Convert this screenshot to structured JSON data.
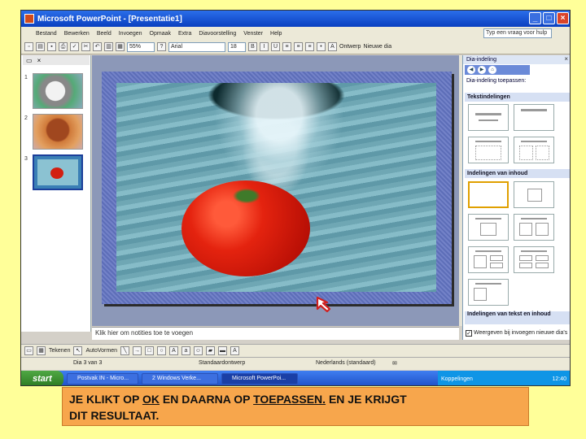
{
  "window": {
    "title": "Microsoft PowerPoint - [Presentatie1]",
    "buttons": [
      "_",
      "□",
      "×"
    ]
  },
  "menu": {
    "items": [
      "Bestand",
      "Bewerken",
      "Beeld",
      "Invoegen",
      "Opmaak",
      "Extra",
      "Diavoorstelling",
      "Venster",
      "Help"
    ],
    "help_placeholder": "Typ een vraag voor hulp"
  },
  "toolbar": {
    "zoom": "55%",
    "font": "Arial",
    "size": "18",
    "design_label": "Ontwerp",
    "new_slide_label": "Nieuwe dia"
  },
  "outline": {
    "tabs": [
      "▭",
      "×"
    ],
    "slides": [
      {
        "number": "1"
      },
      {
        "number": "2"
      },
      {
        "number": "3"
      }
    ]
  },
  "notes": {
    "placeholder": "Klik hier om notities toe te voegen"
  },
  "taskpane": {
    "title": "Dia-indeling",
    "close": "×",
    "subtitle": "Dia-indeling toepassen:",
    "sections": {
      "text": "Tekstindelingen",
      "content": "Indelingen van inhoud",
      "text_content": "Indelingen van tekst en inhoud"
    },
    "checkbox_label": "Weergeven bij invoegen nieuwe dia's"
  },
  "drawbar": {
    "draw_label": "Tekenen",
    "autoshapes_label": "AutoVormen"
  },
  "statusbar": {
    "slide": "Dia 3 van 3",
    "design": "Standaardontwerp",
    "language": "Nederlands (standaard)"
  },
  "taskbar": {
    "start": "start",
    "tasks": [
      "Postvak IN - Micro...",
      "2 Windows Verke...",
      "Microsoft PowerPoi..."
    ],
    "tray_label": "Koppelingen",
    "clock": "12:40"
  },
  "caption": {
    "line1_a": "JE KLIKT OP ",
    "line1_ok": "OK",
    "line1_b": " EN DAARNA OP ",
    "line1_apply": "TOEPASSEN.",
    "line1_c": " EN JE KRIJGT",
    "line2": "DIT RESULTAAT."
  },
  "colors": {
    "background": "#ffff99",
    "caption_bg": "#f7a64c",
    "titlebar": "#0a3fc0",
    "arrow": "#d02020"
  }
}
